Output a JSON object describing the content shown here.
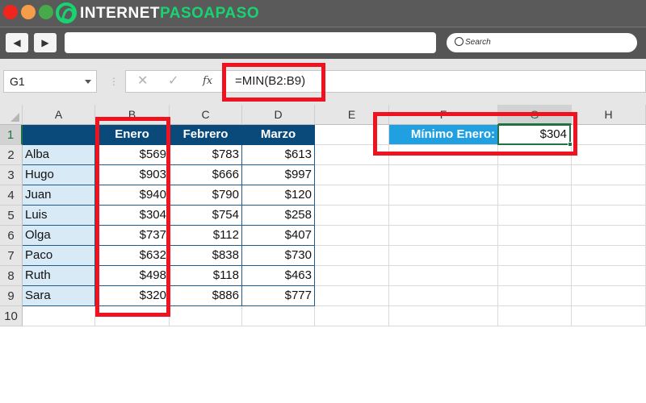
{
  "browser": {
    "logo_part1": "INTERNET",
    "logo_part2": "PASOAPASO",
    "back_label": "◀",
    "forward_label": "▶",
    "url_value": "",
    "search_placeholder": "Search"
  },
  "formula_bar": {
    "name_box": "G1",
    "cancel_icon": "✕",
    "enter_icon": "✓",
    "fx_label": "fx",
    "formula": "=MIN(B2:B9)"
  },
  "columns": [
    "A",
    "B",
    "C",
    "D",
    "E",
    "F",
    "G",
    "H"
  ],
  "rows": [
    "1",
    "2",
    "3",
    "4",
    "5",
    "6",
    "7",
    "8",
    "9",
    "10"
  ],
  "table": {
    "headers": [
      "",
      "Enero",
      "Febrero",
      "Marzo"
    ],
    "records": [
      {
        "name": "Alba",
        "enero": "$569",
        "febrero": "$783",
        "marzo": "$613"
      },
      {
        "name": "Hugo",
        "enero": "$903",
        "febrero": "$666",
        "marzo": "$997"
      },
      {
        "name": "Juan",
        "enero": "$940",
        "febrero": "$790",
        "marzo": "$120"
      },
      {
        "name": "Luis",
        "enero": "$304",
        "febrero": "$754",
        "marzo": "$258"
      },
      {
        "name": "Olga",
        "enero": "$737",
        "febrero": "$112",
        "marzo": "$407"
      },
      {
        "name": "Paco",
        "enero": "$632",
        "febrero": "$838",
        "marzo": "$730"
      },
      {
        "name": "Ruth",
        "enero": "$498",
        "febrero": "$118",
        "marzo": "$463"
      },
      {
        "name": "Sara",
        "enero": "$320",
        "febrero": "$886",
        "marzo": "$777"
      }
    ]
  },
  "result": {
    "label": "Mínimo Enero:",
    "value": "$304"
  },
  "colors": {
    "header_fill": "#0a4a7a",
    "name_fill": "#d9eaf7",
    "label_fill": "#20a0e0",
    "highlight": "#f0121e",
    "selection": "#217346"
  }
}
